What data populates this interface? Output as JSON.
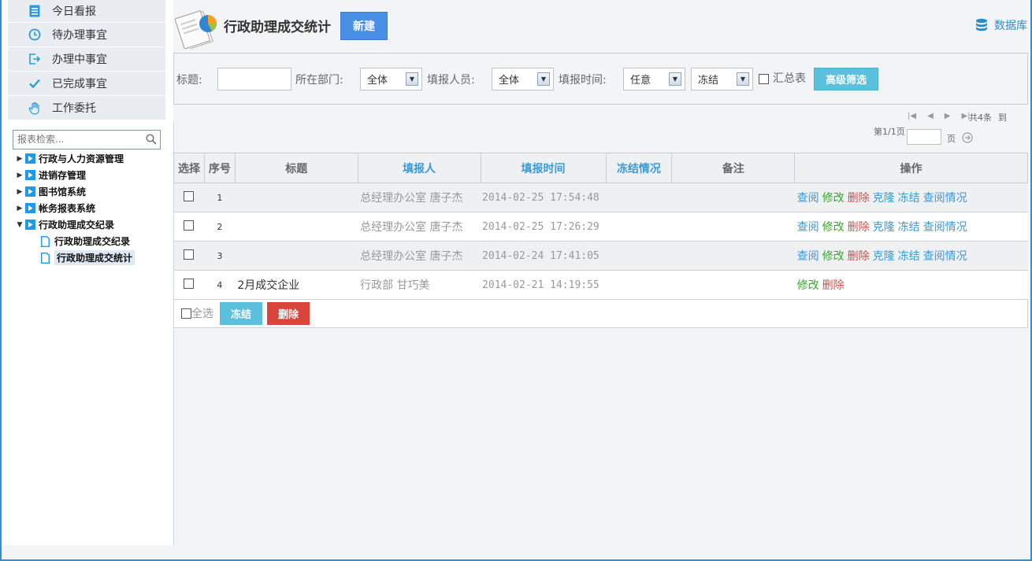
{
  "menu": [
    {
      "label": "今日看报",
      "icon": "list-icon"
    },
    {
      "label": "待办理事宜",
      "icon": "clock-icon"
    },
    {
      "label": "办理中事宜",
      "icon": "arrow-out-icon"
    },
    {
      "label": "已完成事宜",
      "icon": "check-icon"
    },
    {
      "label": "工作委托",
      "icon": "hand-icon"
    }
  ],
  "tree": {
    "search_placeholder": "报表检索...",
    "nodes": [
      {
        "label": "行政与人力资源管理",
        "expanded": false
      },
      {
        "label": "进销存管理",
        "expanded": false
      },
      {
        "label": "图书馆系统",
        "expanded": false
      },
      {
        "label": "帐务报表系统",
        "expanded": false
      },
      {
        "label": "行政助理成交纪录",
        "expanded": true
      }
    ],
    "children": [
      {
        "label": "行政助理成交纪录",
        "selected": false
      },
      {
        "label": "行政助理成交统计",
        "selected": true
      }
    ]
  },
  "header": {
    "title": "行政助理成交统计",
    "new_button": "新建",
    "db_link": "数据库"
  },
  "filter": {
    "title_label": "标题:",
    "title_value": "",
    "dept_label": "所在部门:",
    "dept_value": "全体",
    "reporter_label": "填报人员:",
    "reporter_value": "全体",
    "time_label": "填报时间:",
    "time_value": "任意",
    "freeze_value": "冻结",
    "summary_label": "汇总表",
    "advanced_button": "高级筛选"
  },
  "pager": {
    "total": "共4条",
    "goto": "到",
    "page_info": "第1/1页",
    "page_unit": "页"
  },
  "table": {
    "headers": [
      "选择",
      "序号",
      "标题",
      "填报人",
      "填报时间",
      "冻结情况",
      "备注",
      "操作"
    ],
    "rows": [
      {
        "seq": "1",
        "title": "",
        "reporter": "总经理办公室  唐子杰",
        "time": "2014-02-25 17:54:48",
        "freeze": "",
        "note": "",
        "ops": [
          "查阅",
          "修改",
          "删除",
          "克隆",
          "冻结",
          "查阅情况"
        ]
      },
      {
        "seq": "2",
        "title": "",
        "reporter": "总经理办公室  唐子杰",
        "time": "2014-02-25 17:26:29",
        "freeze": "",
        "note": "",
        "ops": [
          "查阅",
          "修改",
          "删除",
          "克隆",
          "冻结",
          "查阅情况"
        ]
      },
      {
        "seq": "3",
        "title": "",
        "reporter": "总经理办公室  唐子杰",
        "time": "2014-02-24 17:41:05",
        "freeze": "",
        "note": "",
        "ops": [
          "查阅",
          "修改",
          "删除",
          "克隆",
          "冻结",
          "查阅情况"
        ]
      },
      {
        "seq": "4",
        "title": "2月成交企业",
        "reporter": "行政部  甘巧美",
        "time": "2014-02-21 14:19:55",
        "freeze": "",
        "note": "",
        "ops": [
          "修改",
          "删除"
        ]
      }
    ]
  },
  "footer": {
    "select_all": "全选",
    "freeze_button": "冻结",
    "delete_button": "删除"
  },
  "colors": {
    "accent_blue": "#3a9ad6",
    "op_green": "#3fa336",
    "op_red": "#d24d4d",
    "new_button": "#4a8fe6",
    "filter_button": "#5bbfde",
    "delete_button": "#d9453a"
  }
}
